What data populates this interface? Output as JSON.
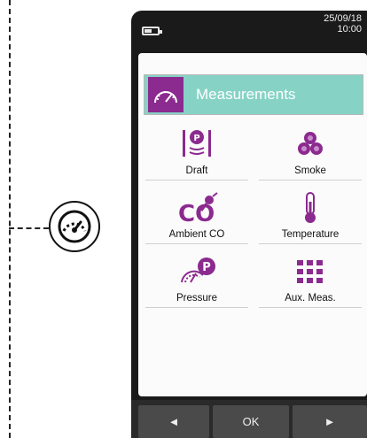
{
  "status": {
    "date": "25/09/18",
    "time": "10:00"
  },
  "header": {
    "title": "Measurements",
    "icon": "gauge-icon"
  },
  "items": [
    {
      "label": "Draft",
      "icon": "draft-icon"
    },
    {
      "label": "Smoke",
      "icon": "smoke-icon"
    },
    {
      "label": "Ambient CO",
      "icon": "co-icon"
    },
    {
      "label": "Temperature",
      "icon": "thermometer-icon"
    },
    {
      "label": "Pressure",
      "icon": "pressure-icon"
    },
    {
      "label": "Aux. Meas.",
      "icon": "grid-icon"
    }
  ],
  "nav": {
    "prev": "◄",
    "ok": "OK",
    "next": "►"
  },
  "colors": {
    "accent": "#8b2a8f",
    "header": "#86d3c6"
  }
}
